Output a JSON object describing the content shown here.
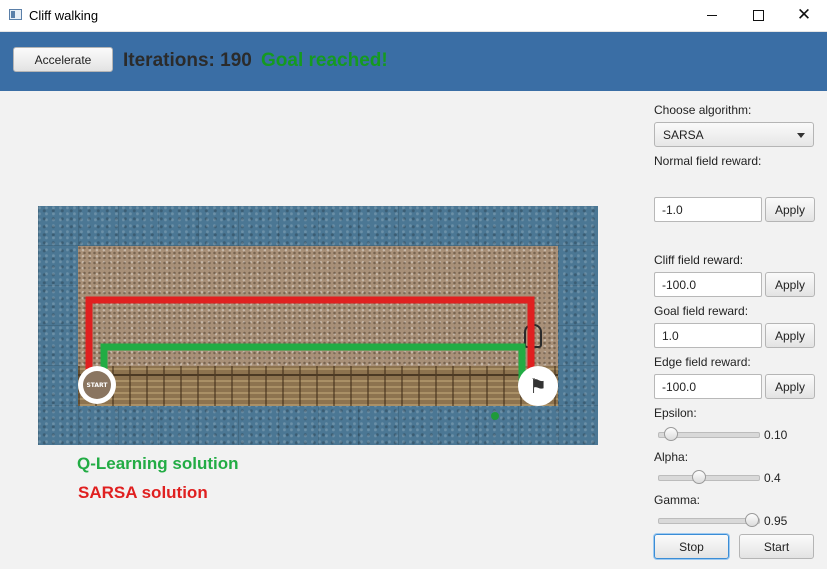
{
  "window": {
    "title": "Cliff walking",
    "icon": "app-window-icon"
  },
  "header": {
    "accelerate_label": "Accelerate",
    "iterations_text": "Iterations: 190",
    "status_text": "Goal reached!",
    "status_color": "#159a20",
    "background": "#3a6ea5"
  },
  "board": {
    "start_label": "START",
    "goal_icon": "checkered-flag-icon",
    "q_path_color": "#22ac44",
    "sarsa_path_color": "#e02020"
  },
  "legend": {
    "q_learning": "Q-Learning solution",
    "sarsa": "SARSA  solution"
  },
  "controls": {
    "algorithm_label": "Choose algorithm:",
    "algorithm_value": "SARSA",
    "normal_label": "Normal field reward:",
    "normal_value": "-1.0",
    "cliff_label": "Cliff field reward:",
    "cliff_value": "-100.0",
    "goal_label": "Goal field reward:",
    "goal_value": "1.0",
    "edge_label": "Edge field reward:",
    "edge_value": "-100.0",
    "apply_label": "Apply",
    "epsilon_label": "Epsilon:",
    "epsilon_value": "0.10",
    "alpha_label": "Alpha:",
    "alpha_value": "0.4",
    "gamma_label": "Gamma:",
    "gamma_value": "0.95",
    "stop_label": "Stop",
    "start_label": "Start"
  }
}
